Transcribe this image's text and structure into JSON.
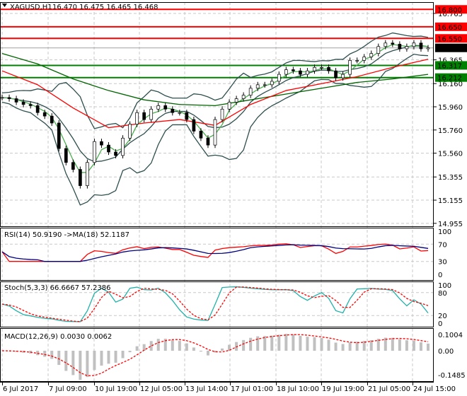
{
  "header": {
    "symbol": "XAGUSD,H1",
    "ohlc": "16.470 16.475 16.465 16.468"
  },
  "colors": {
    "resistance": "#ff0000",
    "support": "#008000",
    "price_tag": "#000000",
    "rsi": "#ff0000",
    "rsi_ma": "#000080",
    "stoch_main": "#20b2aa",
    "stoch_signal": "#ff0000",
    "macd_hist": "#c0c0c0",
    "macd_signal": "#ff0000",
    "ma_slow": "#006400",
    "ma_mid": "#ff0000",
    "bands": "#2f4f4f"
  },
  "chart_data": [
    {
      "type": "candlestick",
      "title": "XAGUSD,H1",
      "ylim": [
        14.955,
        16.8
      ],
      "y_ticks": [
        "16.765",
        "16.365",
        "16.160",
        "15.960",
        "15.760",
        "15.560",
        "15.355",
        "15.155",
        "14.955"
      ],
      "x_ticks": [
        "6 Jul 2017",
        "7 Jul 09:00",
        "10 Jul 19:00",
        "12 Jul 05:00",
        "13 Jul 14:00",
        "17 Jul 01:00",
        "18 Jul 10:00",
        "19 Jul 19:00",
        "21 Jul 05:00",
        "24 Jul 15:00"
      ],
      "close": [
        16.04,
        16.03,
        16.0,
        15.98,
        15.97,
        15.91,
        15.88,
        15.82,
        15.6,
        15.48,
        15.42,
        15.28,
        15.48,
        15.66,
        15.63,
        15.57,
        15.54,
        15.69,
        15.81,
        15.91,
        15.85,
        15.94,
        15.97,
        15.94,
        15.91,
        15.91,
        15.85,
        15.75,
        15.69,
        15.63,
        15.85,
        15.94,
        16.0,
        16.03,
        16.06,
        16.12,
        16.15,
        16.15,
        16.18,
        16.24,
        16.28,
        16.27,
        16.24,
        16.27,
        16.3,
        16.3,
        16.27,
        16.21,
        16.24,
        16.36,
        16.36,
        16.39,
        16.42,
        16.48,
        16.51,
        16.5,
        16.46,
        16.48,
        16.51,
        16.46,
        16.468
      ],
      "ma_slow": [
        16.42,
        16.33,
        16.2,
        16.1,
        16.02,
        15.98,
        15.97,
        16.02,
        16.07,
        16.12,
        16.17,
        16.2,
        16.24
      ],
      "ma_mid": [
        16.27,
        16.15,
        15.95,
        15.78,
        15.82,
        15.85,
        15.8,
        15.98,
        16.1,
        16.16,
        16.22,
        16.3,
        16.37
      ],
      "levels": [
        {
          "label": "16.800",
          "value": 16.8,
          "kind": "resistance"
        },
        {
          "label": "16.650",
          "value": 16.65,
          "kind": "resistance"
        },
        {
          "label": "16.550",
          "value": 16.55,
          "kind": "resistance"
        },
        {
          "label": "16.468",
          "value": 16.468,
          "kind": "current"
        },
        {
          "label": "16.317",
          "value": 16.317,
          "kind": "support"
        },
        {
          "label": "16.212",
          "value": 16.212,
          "kind": "support"
        }
      ]
    },
    {
      "type": "line",
      "title": "RSI(14) 50.9190  ->MA(18) 52.1187",
      "ylim": [
        0,
        100
      ],
      "y_ticks": [
        "100",
        "70",
        "30",
        "0"
      ]
    },
    {
      "type": "line",
      "title": "Stoch(5,3,3) 66.6667 57.2386",
      "ylim": [
        0,
        100
      ],
      "y_ticks": [
        "100",
        "80",
        "20",
        "0"
      ]
    },
    {
      "type": "bar",
      "title": "MACD(12,26,9) 0.0030 0.0062",
      "ylim": [
        -0.1485,
        0.1004
      ],
      "y_ticks": [
        "0.1004",
        "0.00",
        "-0.1485"
      ]
    }
  ]
}
